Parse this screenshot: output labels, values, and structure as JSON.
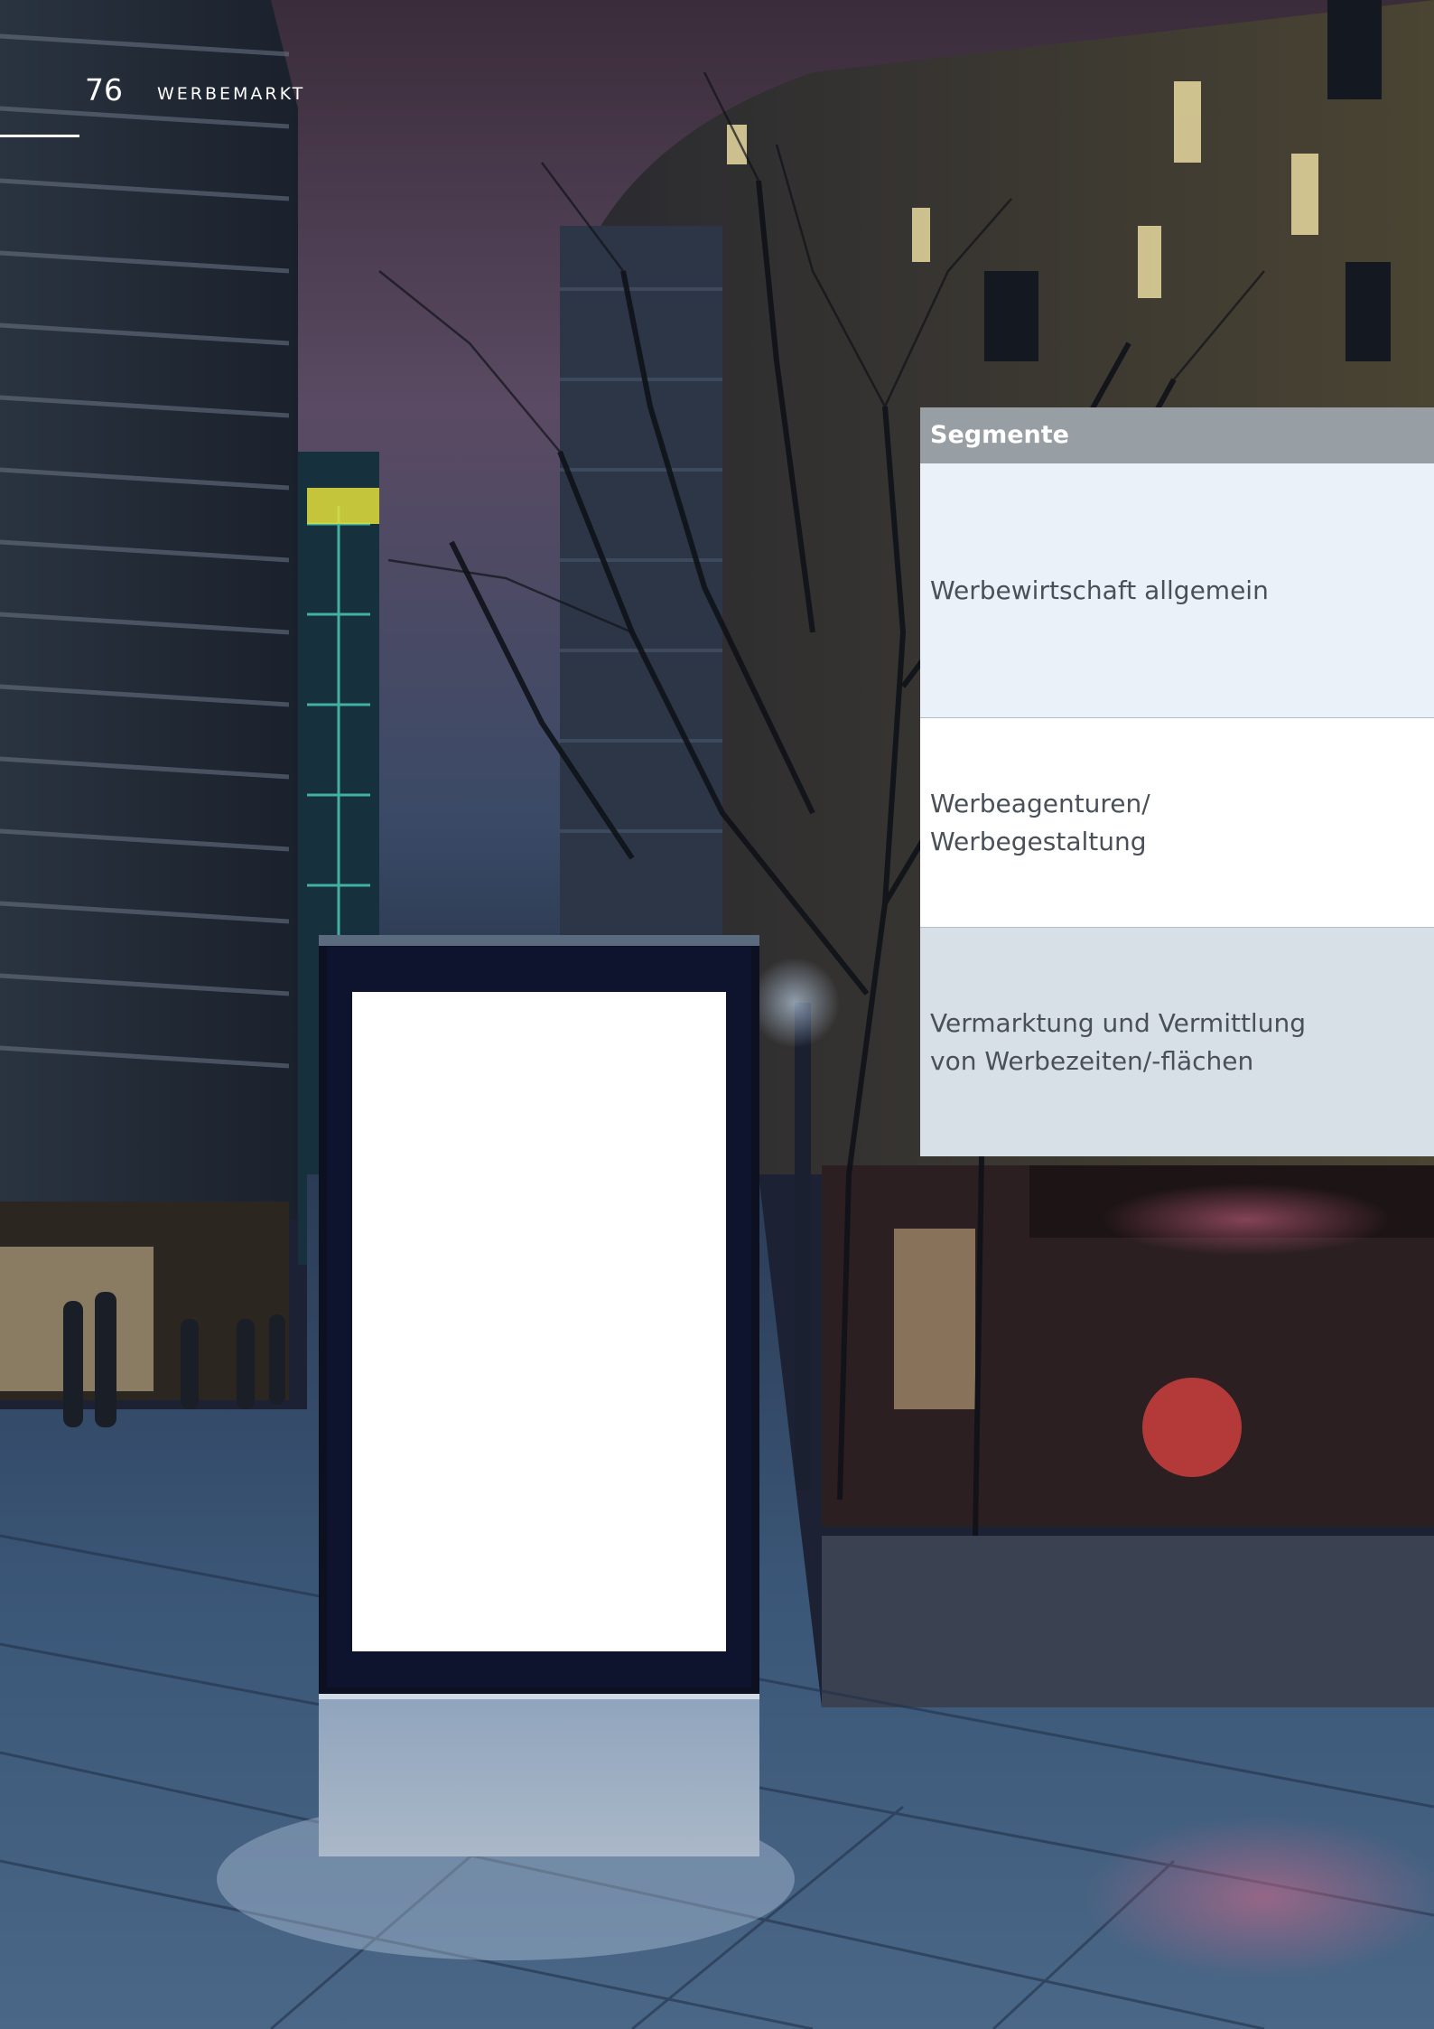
{
  "header": {
    "page_number": "76",
    "section": "WERBEMARKT"
  },
  "photo": {
    "icon": "night-street-billboard-photo"
  },
  "segments": {
    "title": "Segmente",
    "rows": [
      {
        "line1": "Werbewirtschaft allgemein",
        "line2": ""
      },
      {
        "line1": "Werbeagenturen/",
        "line2": "Werbegestaltung"
      },
      {
        "line1": "Vermarktung und Vermittlung",
        "line2": "von Werbezeiten/-flächen"
      }
    ]
  }
}
